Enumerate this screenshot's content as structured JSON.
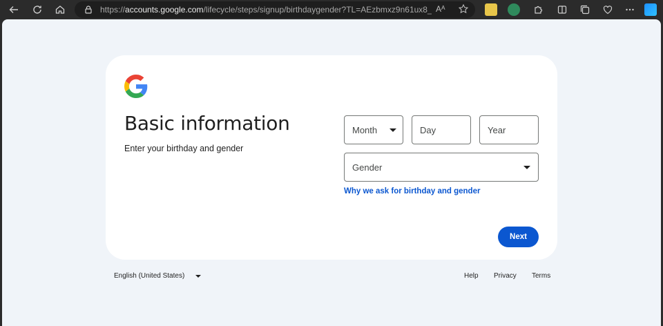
{
  "browser": {
    "url_prefix": "https://",
    "url_domain": "accounts.google.com",
    "url_rest": "/lifecycle/steps/signup/birthdaygender?TL=AEzbmxz9n61ux8_ZMvZ3YuI...",
    "read_aloud": "Aᴬ"
  },
  "card": {
    "title": "Basic information",
    "subtitle": "Enter your birthday and gender",
    "month_label": "Month",
    "day_label": "Day",
    "year_label": "Year",
    "gender_label": "Gender",
    "why_link": "Why we ask for birthday and gender",
    "next_label": "Next"
  },
  "footer": {
    "language": "English (United States)",
    "help": "Help",
    "privacy": "Privacy",
    "terms": "Terms"
  },
  "colors": {
    "accent": "#0b57d0",
    "page_bg": "#f0f4f9",
    "chrome_bg": "#2b2b2b"
  }
}
